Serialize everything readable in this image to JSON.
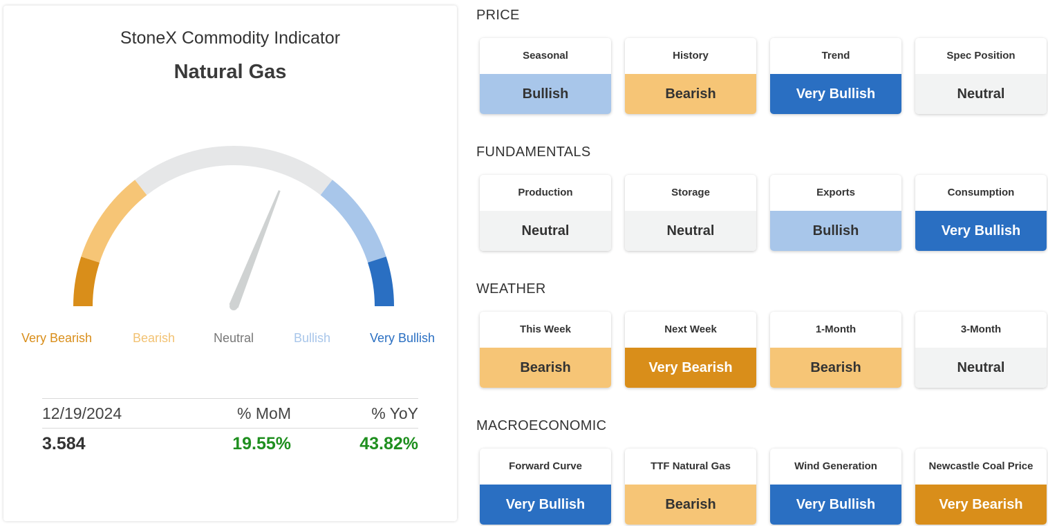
{
  "indicator": {
    "title": "StoneX Commodity Indicator",
    "commodity": "Natural Gas",
    "gauge_value": 0.62,
    "gauge_labels": [
      "Very Bearish",
      "Bearish",
      "Neutral",
      "Bullish",
      "Very Bullish"
    ],
    "stats": {
      "date": "12/19/2024",
      "mom_header": "% MoM",
      "yoy_header": "% YoY",
      "price": "3.584",
      "mom": "19.55%",
      "yoy": "43.82%"
    }
  },
  "colors": {
    "very_bearish": "#d98e1a",
    "bearish": "#f6c576",
    "neutral": "#e6e7e8",
    "bullish": "#a8c6ea",
    "very_bullish": "#2a6fc2",
    "positive": "#1f8f1f"
  },
  "sections": [
    {
      "title": "PRICE",
      "items": [
        {
          "label": "Seasonal",
          "value": "Bullish"
        },
        {
          "label": "History",
          "value": "Bearish"
        },
        {
          "label": "Trend",
          "value": "Very Bullish"
        },
        {
          "label": "Spec Position",
          "value": "Neutral"
        }
      ]
    },
    {
      "title": "FUNDAMENTALS",
      "items": [
        {
          "label": "Production",
          "value": "Neutral"
        },
        {
          "label": "Storage",
          "value": "Neutral"
        },
        {
          "label": "Exports",
          "value": "Bullish"
        },
        {
          "label": "Consumption",
          "value": "Very Bullish"
        }
      ]
    },
    {
      "title": "WEATHER",
      "items": [
        {
          "label": "This Week",
          "value": "Bearish"
        },
        {
          "label": "Next Week",
          "value": "Very Bearish"
        },
        {
          "label": "1-Month",
          "value": "Bearish"
        },
        {
          "label": "3-Month",
          "value": "Neutral"
        }
      ]
    },
    {
      "title": "MACROECONOMIC",
      "items": [
        {
          "label": "Forward Curve",
          "value": "Very Bullish"
        },
        {
          "label": "TTF Natural Gas",
          "value": "Bearish"
        },
        {
          "label": "Wind Generation",
          "value": "Very Bullish"
        },
        {
          "label": "Newcastle Coal Price",
          "value": "Very Bearish"
        }
      ]
    }
  ]
}
